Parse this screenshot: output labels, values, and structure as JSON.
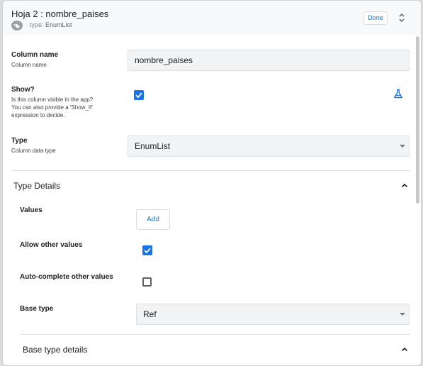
{
  "header": {
    "title": "Hoja 2 : nombre_paises",
    "type_prefix": "type:",
    "type_value": "EnumList",
    "done_label": "Done"
  },
  "column_name": {
    "label": "Column name",
    "description": "Column name",
    "value": "nombre_paises"
  },
  "show": {
    "label": "Show?",
    "description_line1": "Is this column visible in the app?",
    "description_line2": "You can also provide a 'Show_If'",
    "description_line3": "expression to decide.",
    "checked": true
  },
  "type": {
    "label": "Type",
    "description": "Column data type",
    "value": "EnumList"
  },
  "type_details": {
    "title": "Type Details",
    "values_label": "Values",
    "add_label": "Add",
    "allow_other_label": "Allow other values",
    "allow_other_checked": true,
    "autocomplete_label": "Auto-complete other values",
    "autocomplete_checked": false,
    "base_type_label": "Base type",
    "base_type_value": "Ref"
  },
  "base_type_details": {
    "title": "Base type details"
  },
  "colors": {
    "accent": "#1a73e8",
    "panel_bg": "#ffffff",
    "header_bg": "#f8f9fa",
    "field_bg": "#f1f3f4"
  }
}
